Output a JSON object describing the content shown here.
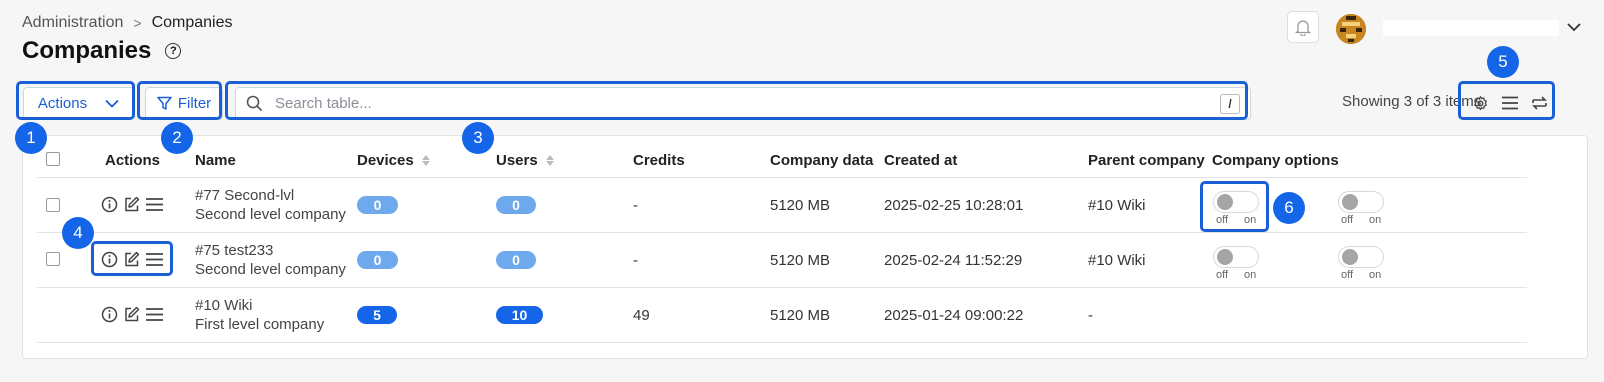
{
  "breadcrumb": {
    "parent": "Administration",
    "separator": ">",
    "current": "Companies"
  },
  "page": {
    "title": "Companies",
    "help": "?"
  },
  "toolbar": {
    "actions_label": "Actions",
    "filter_label": "Filter",
    "search_placeholder": "Search table...",
    "search_shortcut": "/",
    "showing": "Showing 3 of 3 items"
  },
  "annotations": [
    "1",
    "2",
    "3",
    "4",
    "5",
    "6"
  ],
  "table": {
    "headers": {
      "actions": "Actions",
      "name": "Name",
      "devices": "Devices",
      "users": "Users",
      "credits": "Credits",
      "company_data": "Company data",
      "created_at": "Created at",
      "parent_company": "Parent company",
      "company_options": "Company options"
    },
    "rows": [
      {
        "title": "#77 Second-lvl",
        "subtitle": "Second level company",
        "devices": "0",
        "users": "0",
        "credits": "-",
        "company_data": "5120 MB",
        "created_at": "2025-02-25 10:28:01",
        "parent": "#10 Wiki",
        "toggle_off": "off",
        "toggle_on": "on"
      },
      {
        "title": "#75 test233",
        "subtitle": "Second level company",
        "devices": "0",
        "users": "0",
        "credits": "-",
        "company_data": "5120 MB",
        "created_at": "2025-02-24 11:52:29",
        "parent": "#10 Wiki",
        "toggle_off": "off",
        "toggle_on": "on"
      },
      {
        "title": "#10 Wiki",
        "subtitle": "First level company",
        "devices": "5",
        "users": "10",
        "credits": "49",
        "company_data": "5120 MB",
        "created_at": "2025-01-24 09:00:22",
        "parent": "-"
      }
    ]
  },
  "colors": {
    "accent": "#1565e8",
    "pill_light": "#6ea9ee",
    "background": "#f6f6f6"
  },
  "icons": [
    "bell-icon",
    "avatar",
    "chevron-down-icon",
    "filter-icon",
    "search-icon",
    "settings-icon",
    "density-icon",
    "swap-icon",
    "info-icon",
    "edit-icon",
    "menu-icon"
  ]
}
